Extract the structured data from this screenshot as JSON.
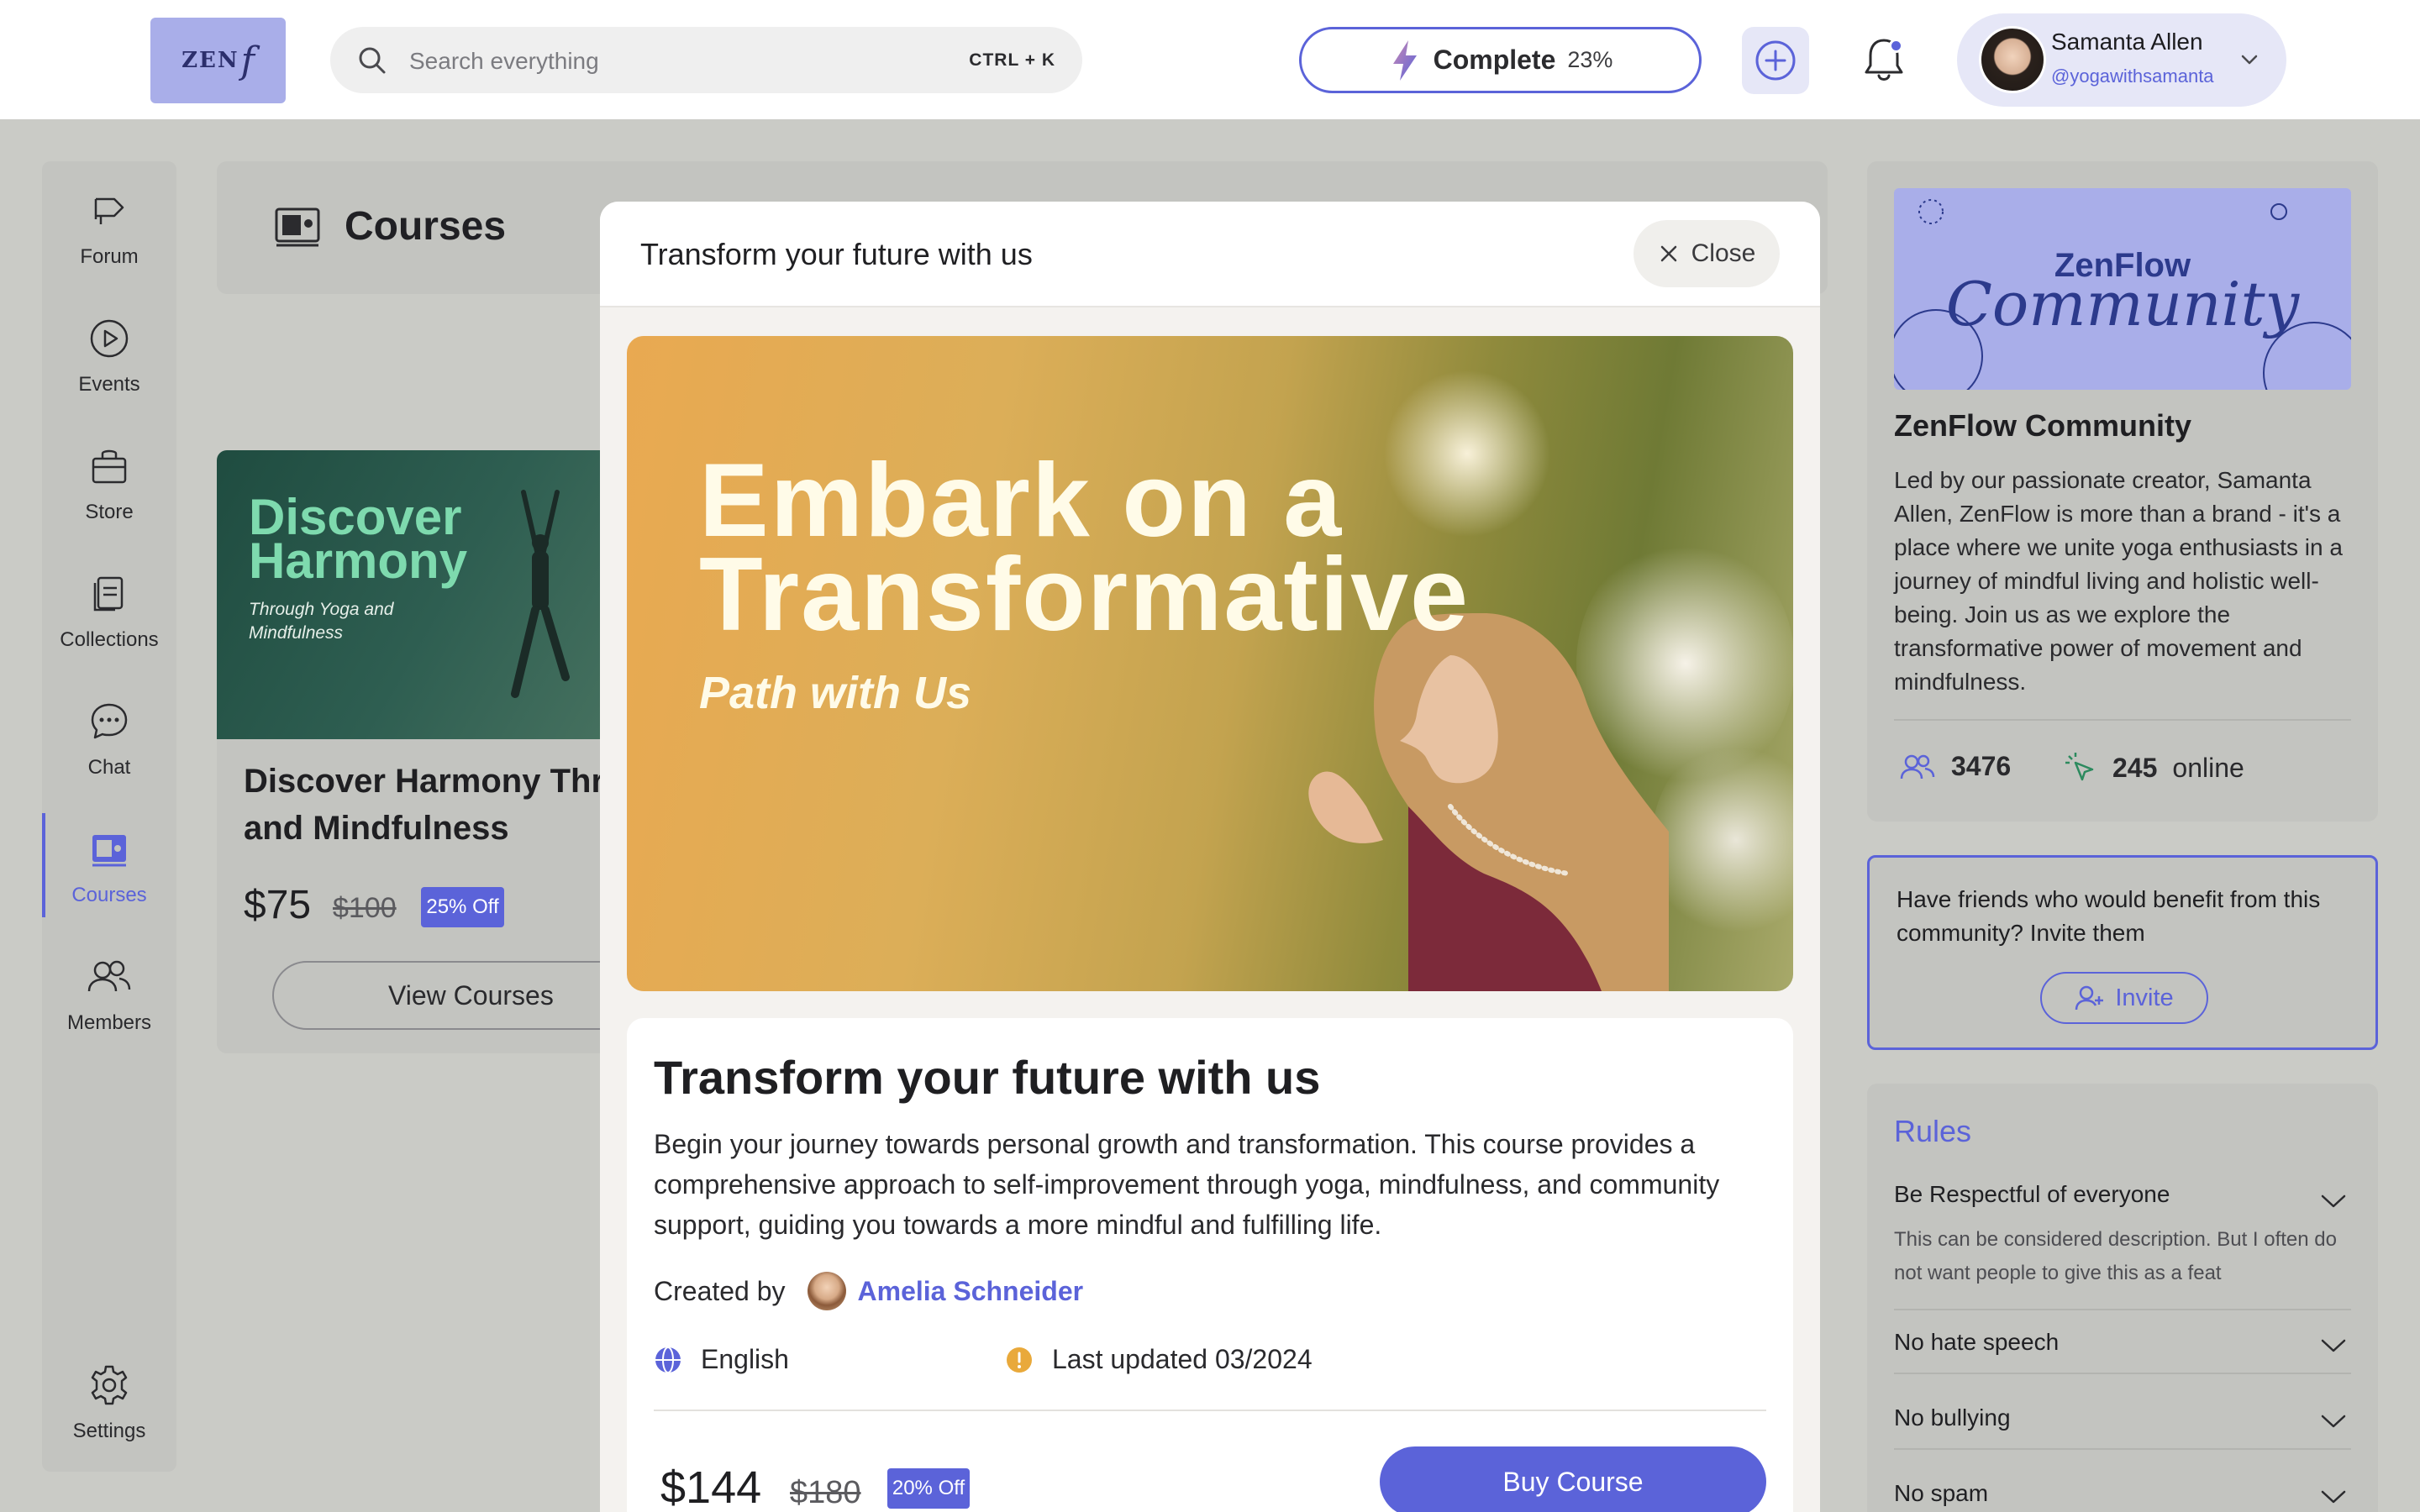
{
  "topbar": {
    "logo_text": "ZENf",
    "search_placeholder": "Search everything",
    "search_shortcut": "CTRL + K",
    "complete_label": "Complete",
    "complete_percent": "23%",
    "complete_progress": 0.23,
    "notification_dot_color": "#5b63d9",
    "user_name": "Samanta Allen",
    "user_handle": "@yogawithsamanta"
  },
  "sidebar": {
    "items": [
      {
        "label": "Forum",
        "icon": "megaphone-icon",
        "active": false
      },
      {
        "label": "Events",
        "icon": "play-circle-icon",
        "active": false
      },
      {
        "label": "Store",
        "icon": "shopping-bag-icon",
        "active": false
      },
      {
        "label": "Collections",
        "icon": "document-stack-icon",
        "active": false
      },
      {
        "label": "Chat",
        "icon": "chat-bubble-icon",
        "active": false
      },
      {
        "label": "Courses",
        "icon": "presentation-icon",
        "active": true
      },
      {
        "label": "Members",
        "icon": "users-icon",
        "active": false
      }
    ],
    "settings_label": "Settings",
    "accent_color": "#5b63d9"
  },
  "main": {
    "page_title": "Courses",
    "course_card": {
      "image_title": "Discover Harmony",
      "image_subtitle": "Through Yoga and Mindfulness",
      "title": "Discover Harmony Through Yoga and Mindfulness",
      "price": "$75",
      "old_price": "$100",
      "discount": "25% Off",
      "button_label": "View Courses"
    }
  },
  "modal": {
    "header_title": "Transform your future with us",
    "close_label": "Close",
    "hero_title": "Embark on a Transformative",
    "hero_subtitle": "Path with Us",
    "title": "Transform your future with us",
    "description": "Begin your journey towards personal growth and transformation. This course provides a comprehensive approach to self-improvement through yoga, mindfulness, and community support, guiding you towards a more mindful and fulfilling life.",
    "created_by_label": "Created by",
    "creator_name": "Amelia Schneider",
    "language": "English",
    "last_updated": "Last updated 03/2024",
    "price": "$144",
    "old_price": "$180",
    "discount": "20% Off",
    "buy_label": "Buy Course"
  },
  "community": {
    "image_title": "ZenFlow",
    "image_script": "Community",
    "title": "ZenFlow Community",
    "description": "Led by our passionate creator, Samanta Allen, ZenFlow is more than a brand - it's a place where we unite yoga enthusiasts in a journey of mindful living and holistic well-being. Join us as we explore the transformative power of movement and mindfulness.",
    "members_count": "3476",
    "online_count": "245",
    "online_label": "online"
  },
  "invite": {
    "question": "Have friends who would benefit from this community? Invite them",
    "button_label": "Invite"
  },
  "rules": {
    "title": "Rules",
    "items": [
      {
        "name": "Be Respectful of everyone",
        "description": "This can be considered description. But I often do not want people to give this as a feat"
      },
      {
        "name": "No hate speech"
      },
      {
        "name": "No bullying"
      },
      {
        "name": "No spam"
      }
    ]
  }
}
